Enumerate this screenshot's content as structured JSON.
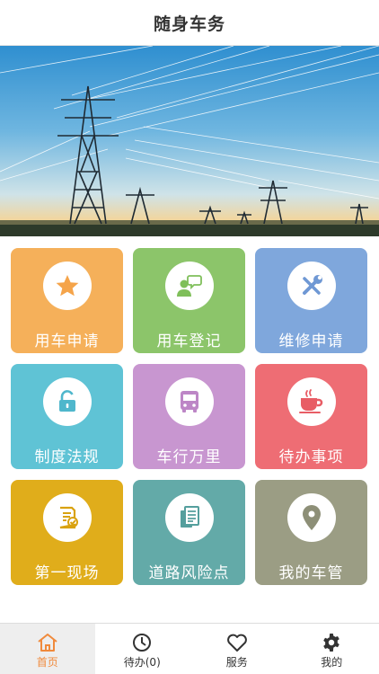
{
  "header": {
    "title": "随身车务"
  },
  "tiles": [
    {
      "label": "用车申请",
      "icon": "star-icon",
      "color": "#f5b05a",
      "icon_color": "#f5a44a"
    },
    {
      "label": "用车登记",
      "icon": "person-chat-icon",
      "color": "#8cc56a",
      "icon_color": "#7fbf5a"
    },
    {
      "label": "维修申请",
      "icon": "tools-icon",
      "color": "#7fa7dc",
      "icon_color": "#6f98d4"
    },
    {
      "label": "制度法规",
      "icon": "unlock-icon",
      "color": "#5fc3d5",
      "icon_color": "#4fb7cc"
    },
    {
      "label": "车行万里",
      "icon": "bus-icon",
      "color": "#c896d0",
      "icon_color": "#bd86c6"
    },
    {
      "label": "待办事项",
      "icon": "coffee-cup-icon",
      "color": "#ee6d74",
      "icon_color": "#e85d65"
    },
    {
      "label": "第一现场",
      "icon": "document-check-icon",
      "color": "#e0ad1b",
      "icon_color": "#d9a210"
    },
    {
      "label": "道路风险点",
      "icon": "documents-icon",
      "color": "#63aaa8",
      "icon_color": "#559f9d"
    },
    {
      "label": "我的车管",
      "icon": "location-pin-icon",
      "color": "#9b9d84",
      "icon_color": "#8d8f77"
    }
  ],
  "tabbar": {
    "active_color": "#f08a3c",
    "items": [
      {
        "label": "首页",
        "icon": "home-icon",
        "active": true
      },
      {
        "label": "待办(0)",
        "icon": "clock-icon",
        "active": false
      },
      {
        "label": "服务",
        "icon": "heart-icon",
        "active": false
      },
      {
        "label": "我的",
        "icon": "gear-icon",
        "active": false
      }
    ]
  }
}
